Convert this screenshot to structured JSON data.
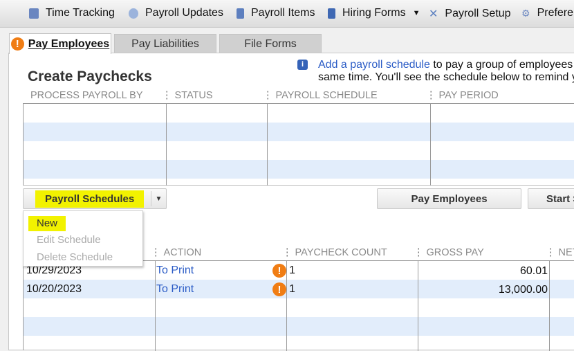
{
  "toolbar": {
    "items": [
      {
        "label": "Time Tracking",
        "icon": "time-tracking-icon"
      },
      {
        "label": "Payroll Updates",
        "icon": "refresh-icon"
      },
      {
        "label": "Payroll Items",
        "icon": "list-icon"
      },
      {
        "label": "Hiring Forms",
        "icon": "document-icon"
      },
      {
        "label": "Payroll Setup",
        "icon": "tools-icon"
      },
      {
        "label": "Prefere",
        "icon": "gear-icon"
      }
    ]
  },
  "tabs": [
    {
      "label": "Pay Employees",
      "active": true
    },
    {
      "label": "Pay Liabilities"
    },
    {
      "label": "File Forms"
    }
  ],
  "title": "Create Paychecks",
  "info": {
    "link": "Add a payroll schedule",
    "line1": " to pay a group of employees a",
    "line2": "same time. You'll see the schedule below to remind yo"
  },
  "schedule_table": {
    "headers": [
      "PROCESS PAYROLL BY",
      "STATUS",
      "PAYROLL SCHEDULE",
      "PAY PERIOD"
    ]
  },
  "buttons": {
    "schedules": "Payroll Schedules",
    "pay": "Pay Employees",
    "start": "Start S"
  },
  "menu": [
    {
      "label": "New",
      "enabled": true
    },
    {
      "label": "Edit Schedule",
      "enabled": false
    },
    {
      "label": "Delete Schedule",
      "enabled": false
    }
  ],
  "paycheck_table": {
    "headers": [
      "ACTION",
      "PAYCHECK COUNT",
      "GROSS PAY",
      "NET"
    ],
    "rows": [
      {
        "date": "10/29/2023",
        "action": "To Print",
        "count": "1",
        "gross": "60.01"
      },
      {
        "date": "10/20/2023",
        "action": "To Print",
        "count": "1",
        "gross": "13,000.00"
      }
    ]
  },
  "colors": {
    "highlight": "#f2f200",
    "link": "#2b5cc6",
    "warning": "#f07d14",
    "row_alt": "#e2edfb"
  }
}
